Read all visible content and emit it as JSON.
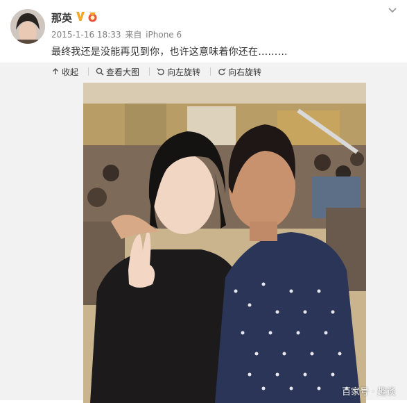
{
  "user": {
    "name": "那英",
    "avatar_alt": "avatar"
  },
  "post": {
    "timestamp": "2015-1-16 18:33",
    "source_prefix": "来自",
    "source": "iPhone 6",
    "text": "最终我还是没能再见到你，也许这意味着你还在………"
  },
  "toolbar": {
    "collapse": "收起",
    "view_large": "查看大图",
    "rotate_left": "向左旋转",
    "rotate_right": "向右旋转"
  },
  "watermark": "百家号 · 趣谈",
  "colors": {
    "accent_orange": "#f5a623",
    "vip_red": "#e8543b"
  },
  "icons": {
    "verified": "verified-v-icon",
    "vip": "vip-medal-icon",
    "menu": "chevron-down-icon"
  }
}
